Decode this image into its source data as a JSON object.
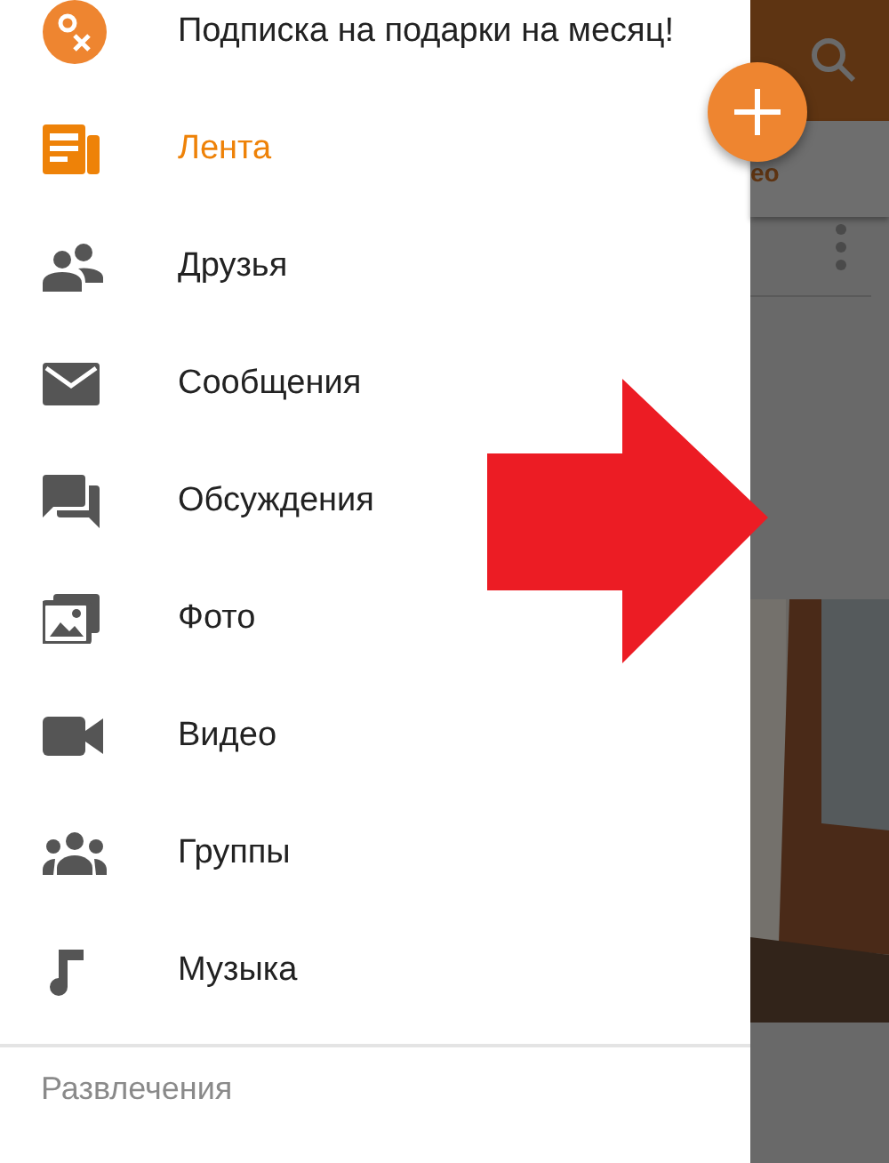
{
  "drawer": {
    "promo": {
      "label": "Подписка на подарки на месяц!"
    },
    "items": [
      {
        "kind": "feed",
        "label": "Лента",
        "selected": true
      },
      {
        "kind": "friends",
        "label": "Друзья",
        "selected": false
      },
      {
        "kind": "messages",
        "label": "Сообщения",
        "selected": false
      },
      {
        "kind": "discussions",
        "label": "Обсуждения",
        "selected": false
      },
      {
        "label": "Фото",
        "selected": false
      },
      {
        "kind": "video",
        "label": "Видео",
        "selected": false
      },
      {
        "kind": "groups",
        "label": "Группы",
        "selected": false
      },
      {
        "kind": "music",
        "label": "Музыка",
        "selected": false
      }
    ],
    "section_header": "Развлечения"
  },
  "background": {
    "tab_label": "ео"
  }
}
